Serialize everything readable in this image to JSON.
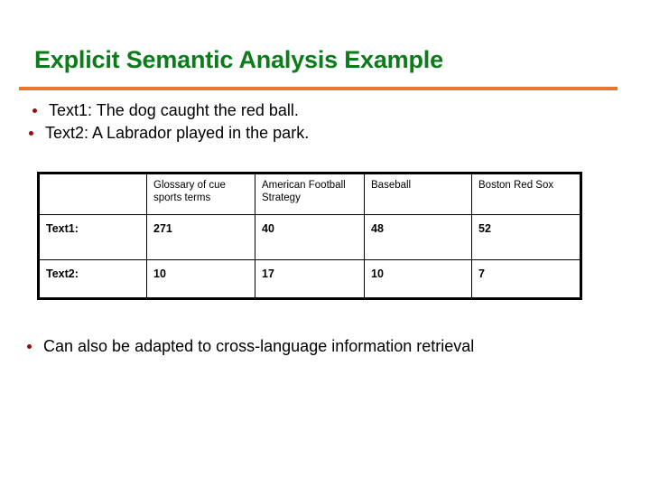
{
  "slide": {
    "title": "Explicit Semantic Analysis Example",
    "accent_rule_color": "#e8762c",
    "title_color": "#0a7c1a",
    "bullet_color": "#8c1111",
    "background_color": "#ffffff"
  },
  "bullets_top": [
    {
      "text": "Text1: The dog caught the red ball."
    },
    {
      "text": "Text2: A Labrador played in the park."
    }
  ],
  "table": {
    "headers": [
      "",
      "Glossary of cue sports terms",
      "American Football Strategy",
      "Baseball",
      "Boston Red Sox"
    ],
    "rows": [
      {
        "label": "Text1:",
        "values": [
          "271",
          "40",
          "48",
          "52"
        ]
      },
      {
        "label": "Text2:",
        "values": [
          "10",
          "17",
          "10",
          "7"
        ]
      }
    ]
  },
  "bullets_bottom": [
    {
      "text": "Can also be adapted to cross-language information retrieval"
    }
  ]
}
